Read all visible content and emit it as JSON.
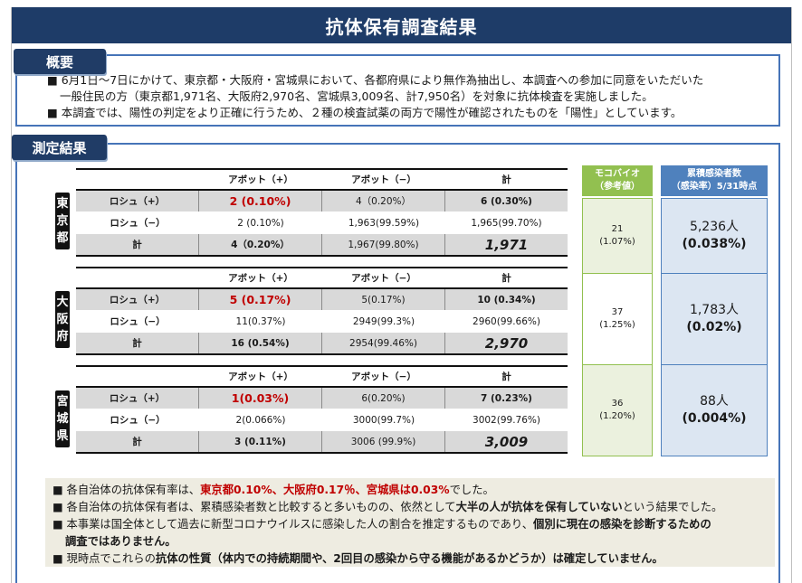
{
  "title": "抗体保有調査結果",
  "overview": {
    "tab": "概要",
    "bullets": [
      [
        "■ 6月1日～7日にかけて、東京都・大阪府・宮城県において、各都府県により無作為抽出し、本調査への参加に同意をいただいた",
        "一般住民の方（東京都1,971名、大阪府2,970名、宮城県3,009名、計7,950名）を対象に抗体検査を実施しました。"
      ],
      [
        "■ 本調査では、陽性の判定をより正確に行うため、２種の検査試薬の両方で陽性が確認されたものを「陽性」としています。"
      ]
    ]
  },
  "results": {
    "tab": "測定結果",
    "col_headers": [
      "",
      "アボット（+）",
      "アボット（−）",
      "計"
    ],
    "prefectures": [
      {
        "label": "東京都",
        "rows": [
          [
            "ロシュ（+）",
            "2 (0.10%)",
            "4（0.20%）",
            "6 (0.30%)"
          ],
          [
            "ロシュ（−）",
            "2 (0.10%)",
            "1,963(99.59%)",
            "1,965(99.70%)"
          ],
          [
            "計",
            "4（0.20%）",
            "1,967(99.80%)",
            "1,971"
          ]
        ],
        "mocobaio": [
          "21",
          "(1.07%)"
        ],
        "cumulative": [
          "5,236人",
          "(0.038%)"
        ]
      },
      {
        "label": "大阪府",
        "rows": [
          [
            "ロシュ（+）",
            "5 (0.17%)",
            "5(0.17%)",
            "10 (0.34%)"
          ],
          [
            "ロシュ（−）",
            "11(0.37%)",
            "2949(99.3%)",
            "2960(99.66%)"
          ],
          [
            "計",
            "16 (0.54%)",
            "2954(99.46%)",
            "2,970"
          ]
        ],
        "mocobaio": [
          "37",
          "(1.25%)"
        ],
        "cumulative": [
          "1,783人",
          "(0.02%)"
        ]
      },
      {
        "label": "宮城県",
        "rows": [
          [
            "ロシュ（+）",
            "1(0.03%)",
            "6(0.20%)",
            "7 (0.23%)"
          ],
          [
            "ロシュ（−）",
            "2(0.066%)",
            "3000(99.7%)",
            "3002(99.76%)"
          ],
          [
            "計",
            "3 (0.11%)",
            "3006 (99.9%)",
            "3,009"
          ]
        ],
        "mocobaio": [
          "36",
          "(1.20%)"
        ],
        "cumulative": [
          "88人",
          "(0.004%)"
        ]
      }
    ],
    "mocobaio_header": [
      "モコバイオ",
      "（参考値）"
    ],
    "cumulative_header": [
      "累積感染者数",
      "（感染率）5/31時点"
    ]
  },
  "notes": {
    "l1": [
      "■ 各自治体の抗体保有率は、",
      "東京都0.10%、大阪府0.17％、宮城県は0.03%",
      "でした。"
    ],
    "l2": [
      "■ 各自治体の抗体保有者は、累積感染者数と比較すると多いものの、依然として",
      "大半の人が抗体を保有していない",
      "という結果でした。"
    ],
    "l3": [
      "■ 本事業は国全体として過去に新型コロナウイルスに感染した人の割合を推定するものであり、",
      "個別に現在の感染を診断するための"
    ],
    "l4": [
      "調査ではありません。"
    ],
    "l5": [
      "■ 現時点でこれらの",
      "抗体の性質（体内での持続期間や、2回目の感染から守る機能があるかどうか）は確定していません。"
    ]
  },
  "colors": {
    "title_bg": "#1e3c68",
    "box_border": "#4674b8",
    "mocobaio": "#92c050",
    "cumulative": "#4f81bd",
    "highlight": "#c00000",
    "notes_bg": "#eeece1"
  }
}
